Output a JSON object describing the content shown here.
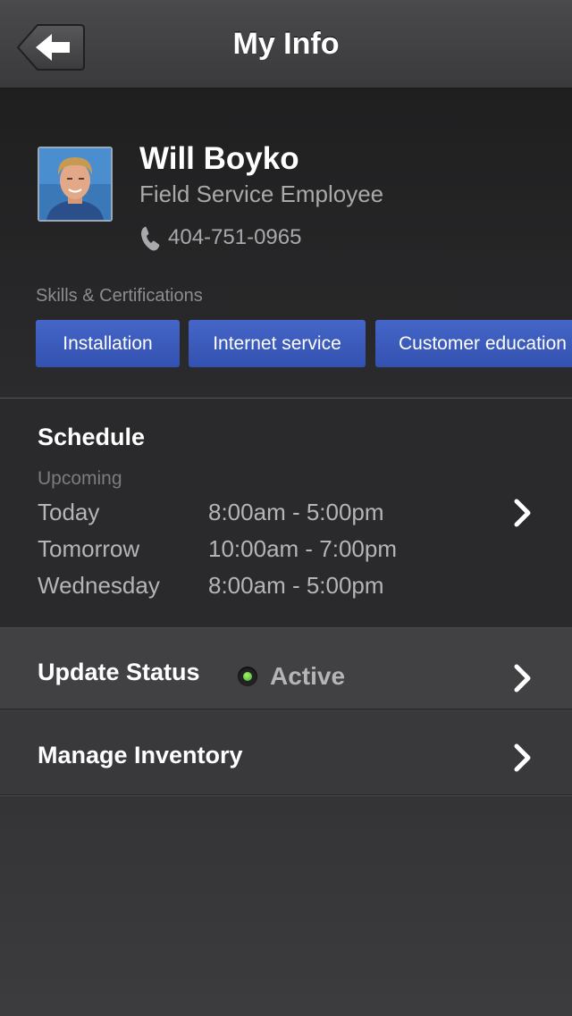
{
  "nav": {
    "title": "My Info",
    "back_icon": "back-arrow-icon"
  },
  "profile": {
    "name": "Will Boyko",
    "role": "Field Service Employee",
    "phone": "404-751-0965",
    "phone_icon": "phone-icon",
    "skills_label": "Skills & Certifications",
    "skills": [
      "Installation",
      "Internet service",
      "Customer education"
    ],
    "chip_color": "#3d5dbf"
  },
  "schedule": {
    "title": "Schedule",
    "subtitle": "Upcoming",
    "rows": [
      {
        "day": "Today",
        "time": "8:00am - 5:00pm"
      },
      {
        "day": "Tomorrow",
        "time": "10:00am - 7:00pm"
      },
      {
        "day": "Wednesday",
        "time": "8:00am - 5:00pm"
      }
    ]
  },
  "status": {
    "label": "Update Status",
    "value": "Active",
    "indicator_color": "#5cc93a"
  },
  "inventory": {
    "label": "Manage Inventory"
  }
}
